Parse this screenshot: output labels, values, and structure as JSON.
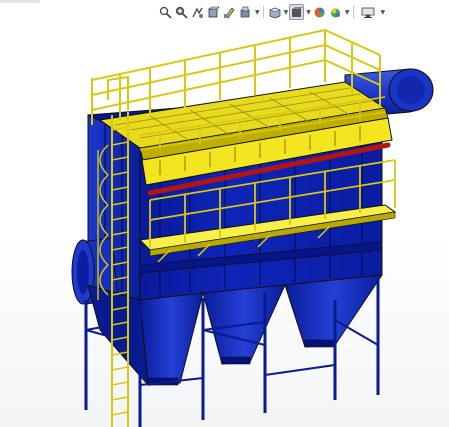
{
  "app": {
    "window": "graphics-area",
    "toolbar_icons": [
      "zoom-to-fit-icon",
      "zoom-to-area-icon",
      "previous-view-icon",
      "section-view-icon",
      "dynamic-annotation-icon",
      "view-orientation-icon",
      "display-style-icon",
      "hide-show-items-icon",
      "edit-appearance-icon",
      "apply-scene-icon",
      "view-settings-icon"
    ]
  },
  "colors": {
    "hull_blue": "#0a1fa8",
    "hull_blue_dark": "#041070",
    "hull_blue_light": "#2a48d8",
    "rail_yellow": "#f2e21a",
    "rail_yellow_dark": "#b8a800",
    "platform_yellow": "#f7ef4a",
    "pipe_red": "#b41414",
    "edge_black": "#111111"
  }
}
